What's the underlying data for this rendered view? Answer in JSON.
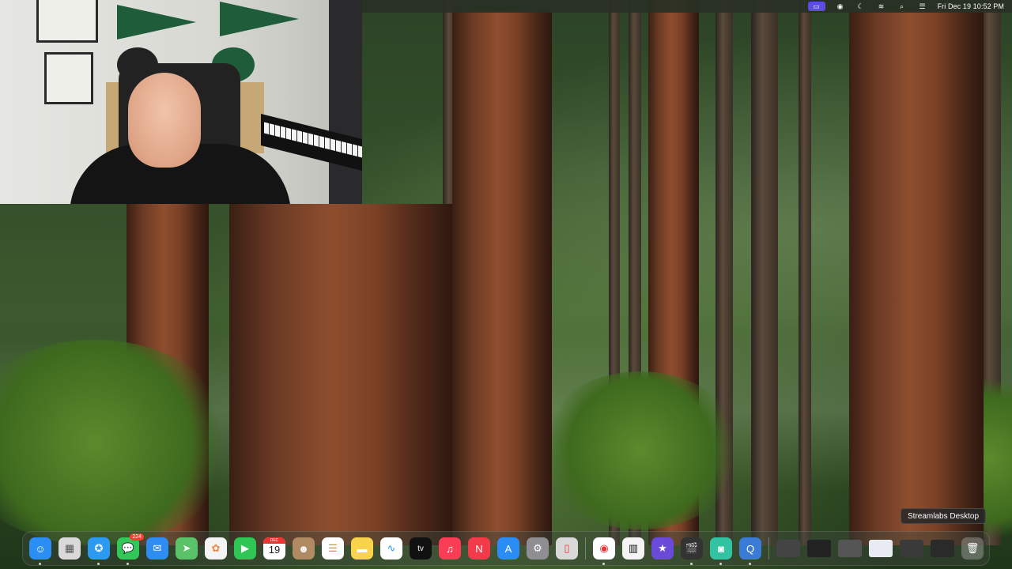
{
  "menubar": {
    "icons": [
      "screen-share-icon",
      "focus-icon",
      "moon-icon",
      "wifi-icon",
      "search-icon",
      "control-center-icon"
    ],
    "clock": "Fri Dec 19  10:52 PM"
  },
  "tooltip": {
    "text": "Streamlabs Desktop"
  },
  "dock": {
    "apps": [
      {
        "name": "Finder",
        "icon": "finder-icon",
        "color": "#2a8ef5",
        "running": true
      },
      {
        "name": "Launchpad",
        "icon": "launchpad-icon",
        "color": "#d9d9d9",
        "running": false
      },
      {
        "name": "Safari",
        "icon": "safari-icon",
        "color": "#2b9af3",
        "running": true
      },
      {
        "name": "Messages",
        "icon": "messages-icon",
        "color": "#33c759",
        "badge": "224",
        "running": true
      },
      {
        "name": "Mail",
        "icon": "mail-icon",
        "color": "#2f8cf2",
        "running": false
      },
      {
        "name": "Maps",
        "icon": "maps-icon",
        "color": "#5ac36a",
        "running": false
      },
      {
        "name": "Photos",
        "icon": "photos-icon",
        "color": "#f4f4f4",
        "running": false
      },
      {
        "name": "FaceTime",
        "icon": "facetime-icon",
        "color": "#2fc656",
        "running": false
      },
      {
        "name": "Calendar",
        "icon": "calendar-icon",
        "color": "#ffffff",
        "month": "DEC",
        "day": "19",
        "running": false
      },
      {
        "name": "Contacts",
        "icon": "contacts-icon",
        "color": "#b08a63",
        "running": false
      },
      {
        "name": "Reminders",
        "icon": "reminders-icon",
        "color": "#ffffff",
        "running": false
      },
      {
        "name": "Notes",
        "icon": "notes-icon",
        "color": "#f7d44c",
        "running": false
      },
      {
        "name": "Freeform",
        "icon": "freeform-icon",
        "color": "#ffffff",
        "running": false
      },
      {
        "name": "TV",
        "icon": "apple-tv-icon",
        "color": "#111111",
        "label": "tv",
        "running": false
      },
      {
        "name": "Music",
        "icon": "music-icon",
        "color": "#fa3d55",
        "running": false
      },
      {
        "name": "News",
        "icon": "news-icon",
        "color": "#f23a4a",
        "running": false
      },
      {
        "name": "App Store",
        "icon": "app-store-icon",
        "color": "#2a8df5",
        "running": false
      },
      {
        "name": "System Settings",
        "icon": "settings-icon",
        "color": "#8e8e93",
        "running": false
      },
      {
        "name": "iPhone Mirroring",
        "icon": "iphone-mirroring-icon",
        "color": "#d9d9d9",
        "running": false
      }
    ],
    "apps_right": [
      {
        "name": "Chrome",
        "icon": "chrome-icon",
        "color": "#ffffff",
        "running": true
      },
      {
        "name": "Piano",
        "icon": "piano-icon",
        "color": "#f4f4f4",
        "running": false
      },
      {
        "name": "iMovie",
        "icon": "imovie-icon",
        "color": "#6a4bd9",
        "running": false
      },
      {
        "name": "Final Cut Pro",
        "icon": "final-cut-icon",
        "color": "#333333",
        "running": true
      },
      {
        "name": "Streamlabs",
        "icon": "streamlabs-icon",
        "color": "#31c3a2",
        "running": true
      },
      {
        "name": "QuickTime",
        "icon": "quicktime-icon",
        "color": "#3a7bd5",
        "running": true
      }
    ],
    "minimized": [
      "window-thumb-1",
      "window-thumb-2",
      "window-thumb-3",
      "window-thumb-4",
      "window-thumb-5",
      "window-thumb-6"
    ],
    "trash": {
      "name": "Trash",
      "icon": "trash-icon"
    }
  }
}
